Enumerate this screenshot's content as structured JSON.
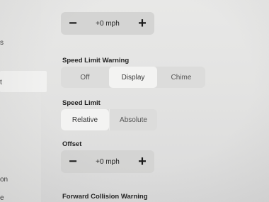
{
  "sidebar": {
    "items": [
      {
        "label": "s"
      },
      {
        "label": "t"
      },
      {
        "label": "on"
      },
      {
        "label": "e"
      }
    ]
  },
  "top_stepper": {
    "minus": "−",
    "value": "+0 mph",
    "plus": "+"
  },
  "speed_limit_warning": {
    "title": "Speed Limit Warning",
    "options": [
      "Off",
      "Display",
      "Chime"
    ],
    "selected": "Display"
  },
  "speed_limit": {
    "title": "Speed Limit",
    "options": [
      "Relative",
      "Absolute"
    ],
    "selected": "Relative"
  },
  "offset": {
    "title": "Offset",
    "minus": "−",
    "value": "+0 mph",
    "plus": "+"
  },
  "forward_collision": {
    "title": "Forward Collision Warning"
  }
}
